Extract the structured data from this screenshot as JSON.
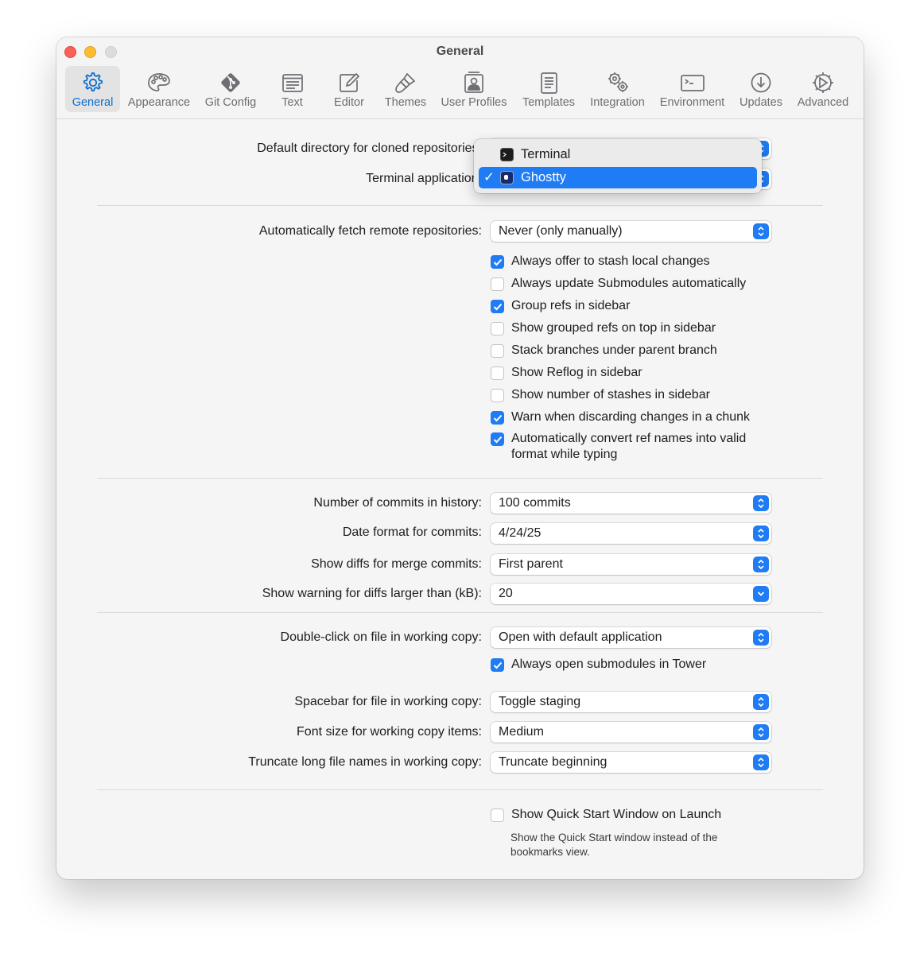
{
  "window": {
    "title": "General"
  },
  "tabs": [
    {
      "label": "General",
      "icon": "gear-icon",
      "active": true
    },
    {
      "label": "Appearance",
      "icon": "palette-icon",
      "active": false
    },
    {
      "label": "Git Config",
      "icon": "git-icon",
      "active": false
    },
    {
      "label": "Text",
      "icon": "text-document-icon",
      "active": false
    },
    {
      "label": "Editor",
      "icon": "pencil-square-icon",
      "active": false
    },
    {
      "label": "Themes",
      "icon": "paintbrush-icon",
      "active": false
    },
    {
      "label": "User Profiles",
      "icon": "person-card-icon",
      "active": false
    },
    {
      "label": "Templates",
      "icon": "template-document-icon",
      "active": false
    },
    {
      "label": "Integration",
      "icon": "gears-icon",
      "active": false
    },
    {
      "label": "Environment",
      "icon": "terminal-window-icon",
      "active": false
    },
    {
      "label": "Updates",
      "icon": "download-circle-icon",
      "active": false
    },
    {
      "label": "Advanced",
      "icon": "advanced-gear-icon",
      "active": false
    }
  ],
  "section1": {
    "default_dir_label": "Default directory for cloned repositories:",
    "terminal_app_label": "Terminal application:"
  },
  "terminal_menu": {
    "items": [
      {
        "label": "Terminal",
        "icon": "terminal-app-icon",
        "selected": false
      },
      {
        "label": "Ghostty",
        "icon": "ghostty-app-icon",
        "selected": true
      }
    ],
    "checkmark": "✓"
  },
  "section2": {
    "fetch_label": "Automatically fetch remote repositories:",
    "fetch_value": "Never (only manually)",
    "checkboxes": [
      {
        "label": "Always offer to stash local changes",
        "checked": true
      },
      {
        "label": "Always update Submodules automatically",
        "checked": false
      },
      {
        "label": "Group refs in sidebar",
        "checked": true
      },
      {
        "label": "Show grouped refs on top in sidebar",
        "checked": false
      },
      {
        "label": "Stack branches under parent branch",
        "checked": false
      },
      {
        "label": "Show Reflog in sidebar",
        "checked": false
      },
      {
        "label": "Show number of stashes in sidebar",
        "checked": false
      },
      {
        "label": "Warn when discarding changes in a chunk",
        "checked": true
      },
      {
        "label": "Automatically convert ref names into valid format while typing",
        "checked": true
      }
    ]
  },
  "section3": {
    "commits_label": "Number of commits in history:",
    "commits_value": "100 commits",
    "date_label": "Date format for commits:",
    "date_value": "4/24/25",
    "merge_label": "Show diffs for merge commits:",
    "merge_value": "First parent",
    "warning_label": "Show warning for diffs larger than (kB):",
    "warning_value": "20"
  },
  "section4": {
    "doubleclick_label": "Double-click on file in working copy:",
    "doubleclick_value": "Open with default application",
    "submodules_checkbox": {
      "label": "Always open submodules in Tower",
      "checked": true
    },
    "spacebar_label": "Spacebar for file in working copy:",
    "spacebar_value": "Toggle staging",
    "fontsize_label": "Font size for working copy items:",
    "fontsize_value": "Medium",
    "truncate_label": "Truncate long file names in working copy:",
    "truncate_value": "Truncate beginning"
  },
  "section5": {
    "quickstart_checkbox": {
      "label": "Show Quick Start Window on Launch",
      "checked": false
    },
    "quickstart_note": "Show the Quick Start window instead of the bookmarks view."
  },
  "colors": {
    "accent": "#1f7cf5",
    "active_tab_label": "#0a6ed1",
    "window_bg": "#f5f5f5"
  }
}
